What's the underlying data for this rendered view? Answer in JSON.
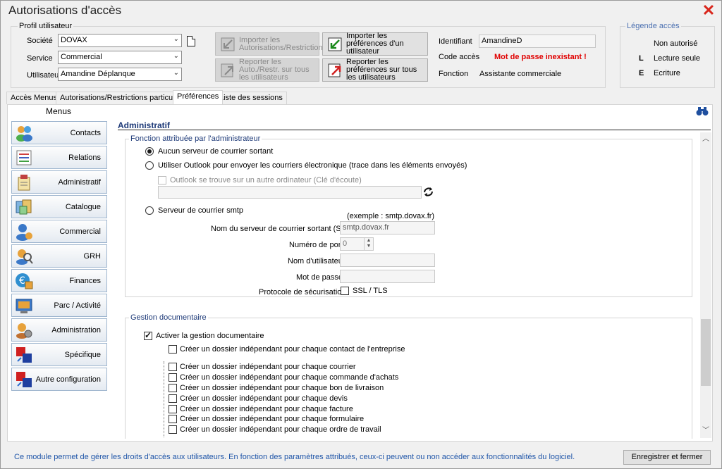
{
  "window": {
    "title": "Autorisations d'accès"
  },
  "profile": {
    "legend": "Profil utilisateur",
    "societe_label": "Société",
    "societe_value": "DOVAX",
    "service_label": "Service",
    "service_value": "Commercial",
    "utilisateur_label": "Utilisateur",
    "utilisateur_value": "Amandine Déplanque",
    "btn_import_autorisations": "Importer les Autorisations/Restrictions",
    "btn_import_preferences": "Importer les préférences d'un utilisateur",
    "btn_report_autorisations": "Reporter les Auto./Restr. sur tous les utilisateurs",
    "btn_report_preferences": "Reporter les préférences sur tous les utilisateurs",
    "identifiant_label": "Identifiant",
    "identifiant_value": "AmandineD",
    "code_acces_label": "Code accès",
    "code_acces_value": "Mot de passe inexistant !",
    "fonction_label": "Fonction",
    "fonction_value": "Assistante commerciale"
  },
  "legend_box": {
    "title": "Légende accès",
    "items": [
      {
        "key": "",
        "label": "Non autorisé"
      },
      {
        "key": "L",
        "label": "Lecture seule"
      },
      {
        "key": "E",
        "label": "Ecriture"
      }
    ]
  },
  "tabs": [
    {
      "label": "Accès Menus"
    },
    {
      "label": "Autorisations/Restrictions particulières"
    },
    {
      "label": "Préférences"
    },
    {
      "label": "Liste des sessions"
    }
  ],
  "sidebar": {
    "title": "Menus",
    "items": [
      {
        "label": "Contacts"
      },
      {
        "label": "Relations"
      },
      {
        "label": "Administratif"
      },
      {
        "label": "Catalogue"
      },
      {
        "label": "Commercial"
      },
      {
        "label": "GRH"
      },
      {
        "label": "Finances"
      },
      {
        "label": "Parc / Activité"
      },
      {
        "label": "Administration"
      },
      {
        "label": "Spécifique"
      },
      {
        "label": "Autre configuration"
      }
    ]
  },
  "section": {
    "title": "Administratif",
    "fonction_group": {
      "legend": "Fonction attribuée par l'administrateur",
      "radio_none": "Aucun serveur de courrier sortant",
      "radio_outlook": "Utiliser Outlook pour envoyer les courriers électronique (trace dans les éléments envoyés)",
      "chk_outlook_remote": "Outlook se trouve sur un autre ordinateur (Clé d'écoute)",
      "radio_smtp": "Serveur de courrier smtp",
      "example": "(exemple :  smtp.dovax.fr)",
      "smtp_server_label": "Nom du serveur de courrier sortant (SMTP)",
      "smtp_server_value": "smtp.dovax.fr",
      "port_label": "Numéro de port",
      "port_value": "0",
      "user_label": "Nom d'utilisateur",
      "password_label": "Mot de passe",
      "security_label": "Protocole de sécurisation",
      "ssl_label": "SSL / TLS"
    },
    "gestion_group": {
      "legend": "Gestion documentaire",
      "activer": "Activer la gestion documentaire",
      "contact_folder": "Créer un dossier indépendant pour chaque contact de l'entreprise",
      "items": [
        {
          "label": "Créer un dossier indépendant pour chaque courrier"
        },
        {
          "label": "Créer un dossier indépendant pour chaque commande d'achats"
        },
        {
          "label": "Créer un dossier indépendant pour chaque bon de livraison"
        },
        {
          "label": "Créer un dossier indépendant pour chaque devis"
        },
        {
          "label": "Créer un dossier indépendant pour chaque facture"
        },
        {
          "label": "Créer un dossier indépendant pour chaque formulaire"
        },
        {
          "label": "Créer un dossier indépendant pour chaque ordre de travail"
        }
      ]
    }
  },
  "footer": {
    "info": "Ce module permet de gérer les droits d'accès aux utilisateurs. En fonction des paramètres attribués, ceux-ci peuvent ou non accéder aux fonctionnalités du logiciel.",
    "save_button": "Enregistrer et fermer"
  },
  "colors": {
    "accent_blue": "#1e3a78",
    "error_red": "#e00000",
    "close_red": "#d9261c"
  }
}
